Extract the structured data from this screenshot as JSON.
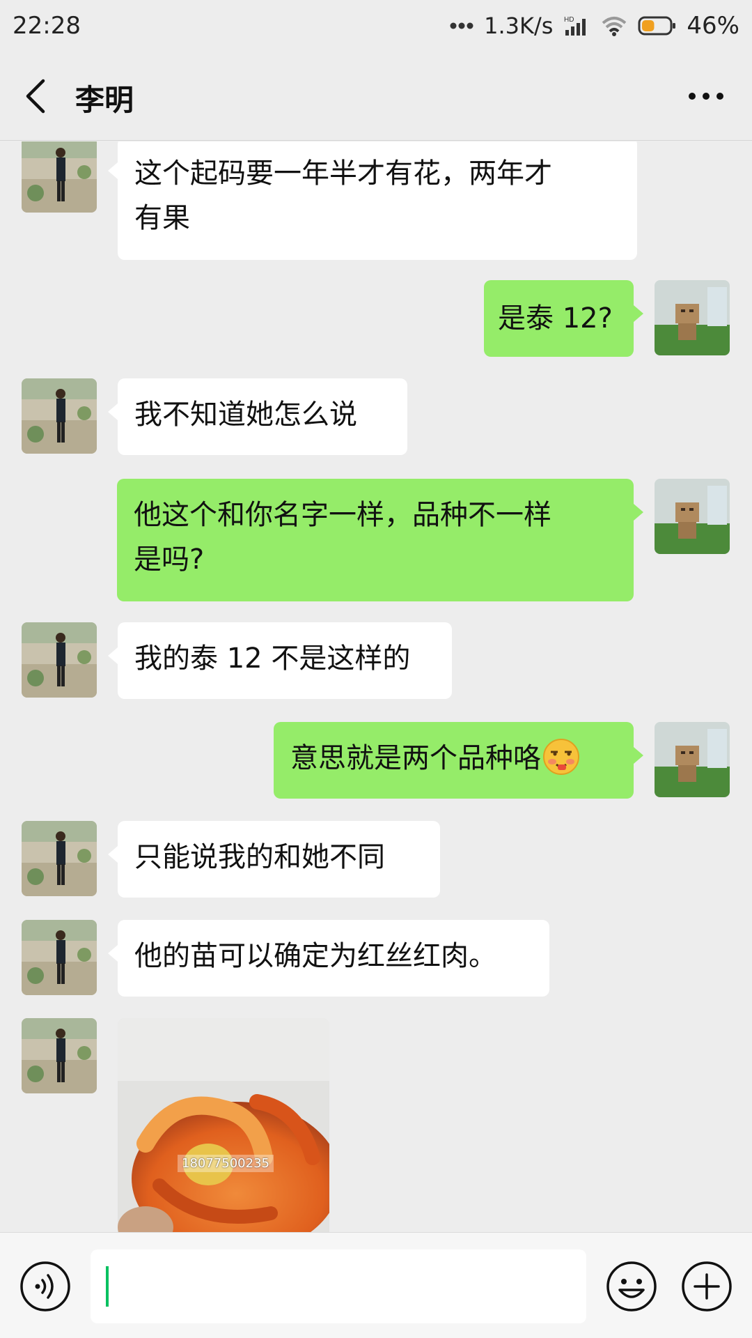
{
  "status": {
    "time": "22:28",
    "net_speed": "1.3K/s",
    "network_label": "HD",
    "battery": "46%",
    "battery_level": 0.46
  },
  "header": {
    "title": "李明",
    "back_icon": "chevron-left-icon",
    "more_icon": "more-dots-icon"
  },
  "messages": [
    {
      "side": "left",
      "text_lines": [
        "这个起码要一年半才有花，两年才",
        "有果"
      ]
    },
    {
      "side": "right",
      "text": "是泰 12?"
    },
    {
      "side": "left",
      "text": "我不知道她怎么说"
    },
    {
      "side": "right",
      "text_lines": [
        "他这个和你名字一样，品种不一样",
        "是吗?"
      ]
    },
    {
      "side": "left",
      "text": "我的泰 12 不是这样的"
    },
    {
      "side": "right",
      "text": "意思就是两个品种咯",
      "emoji": "smirk-face-emoji"
    },
    {
      "side": "left",
      "text": "只能说我的和她不同"
    },
    {
      "side": "left",
      "text": "他的苗可以确定为红丝红肉。"
    },
    {
      "side": "left",
      "type": "image",
      "watermark": "18077500235"
    }
  ],
  "input": {
    "value": "",
    "voice_icon": "voice-icon",
    "emoji_icon": "emoji-icon",
    "plus_icon": "plus-icon"
  },
  "colors": {
    "background": "#ededed",
    "my_bubble": "#95ec69",
    "their_bubble": "#ffffff",
    "cursor": "#07c160"
  }
}
